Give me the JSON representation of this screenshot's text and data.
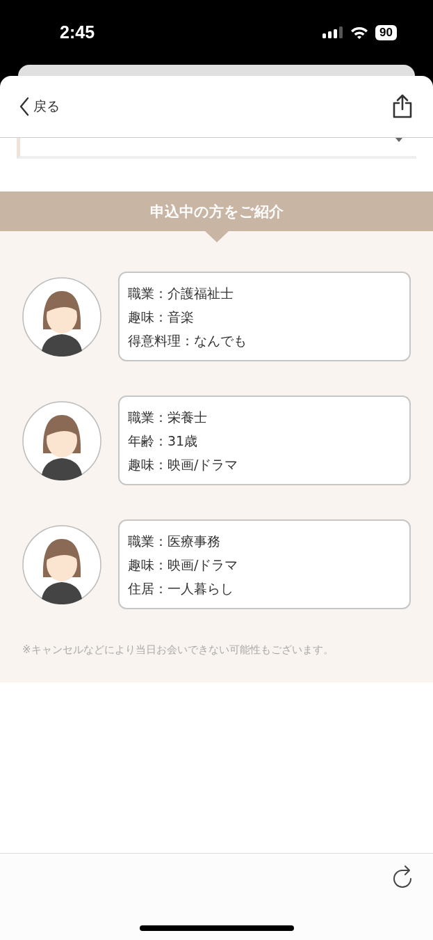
{
  "status_bar": {
    "time": "2:45",
    "battery": "90"
  },
  "nav": {
    "back": "戻る"
  },
  "section": {
    "title": "申込中の方をご紹介"
  },
  "profiles": [
    {
      "lines": [
        "職業：介護福祉士",
        "趣味：音楽",
        "得意料理：なんでも"
      ]
    },
    {
      "lines": [
        "職業：栄養士",
        "年齢：31歳",
        "趣味：映画/ドラマ"
      ]
    },
    {
      "lines": [
        "職業：医療事務",
        "趣味：映画/ドラマ",
        "住居：一人暮らし"
      ]
    }
  ],
  "note": "※キャンセルなどにより当日お会いできない可能性もございます。"
}
